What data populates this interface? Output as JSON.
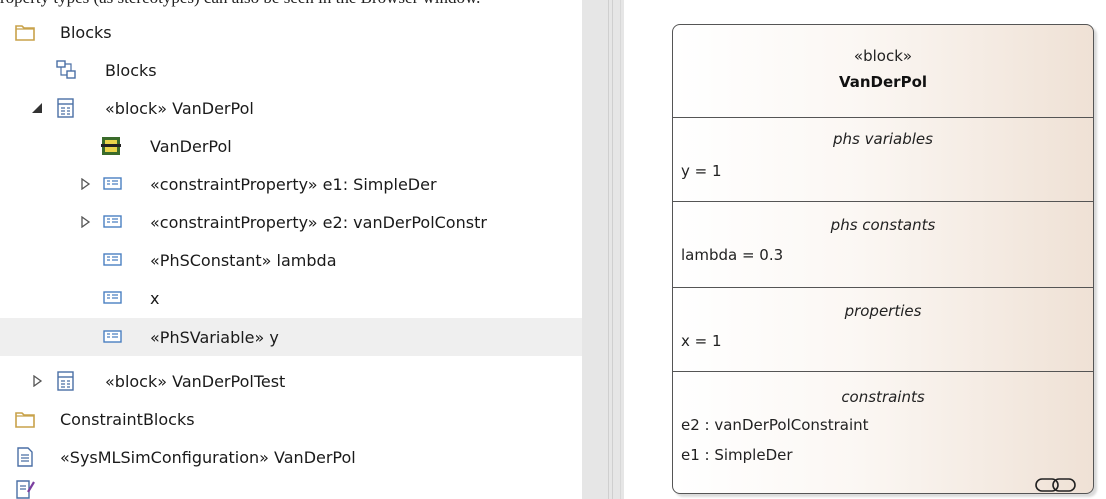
{
  "caption": "roperty types (as stereotypes) can also be seen in the Browser window.",
  "tree": {
    "items": [
      {
        "label": "Blocks",
        "icon": "folder-icon"
      },
      {
        "label": "Blocks",
        "icon": "diagram-icon"
      },
      {
        "label": "«block» VanDerPol",
        "icon": "block-icon",
        "arrow": "expanded"
      },
      {
        "label": "VanDerPol",
        "icon": "ibd-icon"
      },
      {
        "label": "«constraintProperty» e1: SimpleDer",
        "icon": "property-icon",
        "arrow": "collapsed"
      },
      {
        "label": "«constraintProperty» e2: vanDerPolConstr",
        "icon": "property-icon",
        "arrow": "collapsed"
      },
      {
        "label": "«PhSConstant» lambda",
        "icon": "property-icon"
      },
      {
        "label": "x",
        "icon": "property-icon"
      },
      {
        "label": "«PhSVariable» y",
        "icon": "property-icon",
        "selected": true
      },
      {
        "label": "«block» VanDerPolTest",
        "icon": "block-icon",
        "arrow": "collapsed"
      },
      {
        "label": "ConstraintBlocks",
        "icon": "folder-icon"
      },
      {
        "label": "«SysMLSimConfiguration» VanDerPol",
        "icon": "document-icon"
      },
      {
        "label": "",
        "icon": "edit-document-icon"
      }
    ]
  },
  "block": {
    "stereotype": "«block»",
    "name": "VanDerPol",
    "compartments": [
      {
        "title": "phs variables",
        "lines": [
          "y = 1"
        ]
      },
      {
        "title": "phs constants",
        "lines": [
          "lambda = 0.3"
        ]
      },
      {
        "title": "properties",
        "lines": [
          "x = 1"
        ]
      },
      {
        "title": "constraints",
        "lines": [
          "e2 : vanDerPolConstraint",
          "e1 : SimpleDer"
        ]
      }
    ],
    "link_icon": "chain-link-icon"
  },
  "colors": {
    "selection": "#efefef",
    "splitter": "#e6e6e6",
    "block_gradient_end": "#efe1d5"
  }
}
